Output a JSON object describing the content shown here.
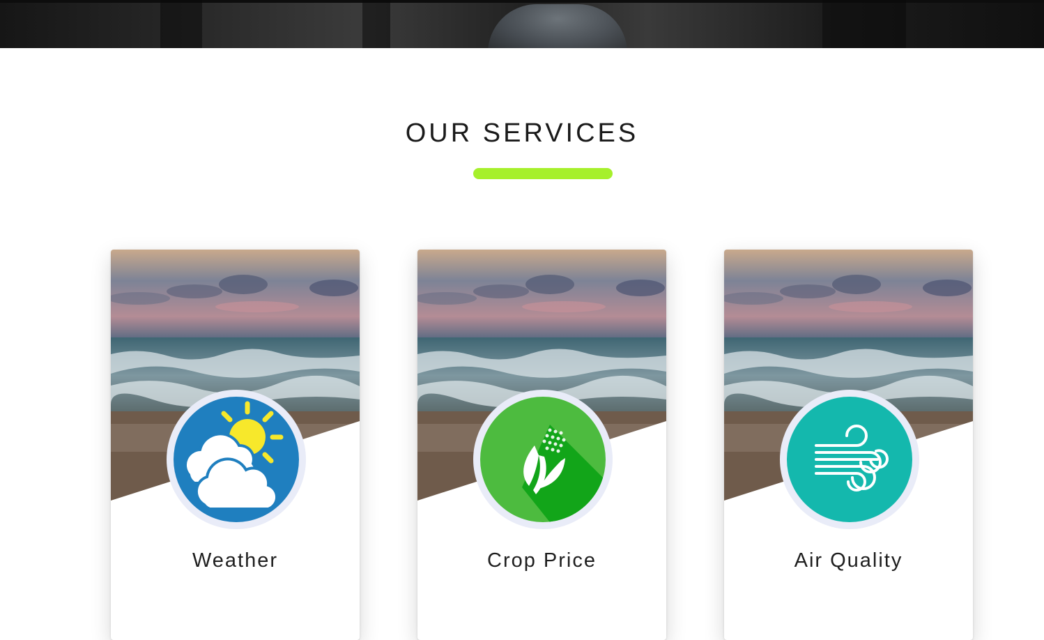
{
  "section": {
    "title": "OUR SERVICES",
    "accent_color": "#a6f02b"
  },
  "services": [
    {
      "title": "Weather",
      "icon": "weather-partly-cloudy-icon",
      "icon_bg": "#1f7fbf"
    },
    {
      "title": "Crop Price",
      "icon": "corn-icon",
      "icon_bg": "#4dbb3f"
    },
    {
      "title": "Air Quality",
      "icon": "wind-icon",
      "icon_bg": "#14b8ad"
    }
  ],
  "card_photo": "ocean-waves-sunset-image"
}
